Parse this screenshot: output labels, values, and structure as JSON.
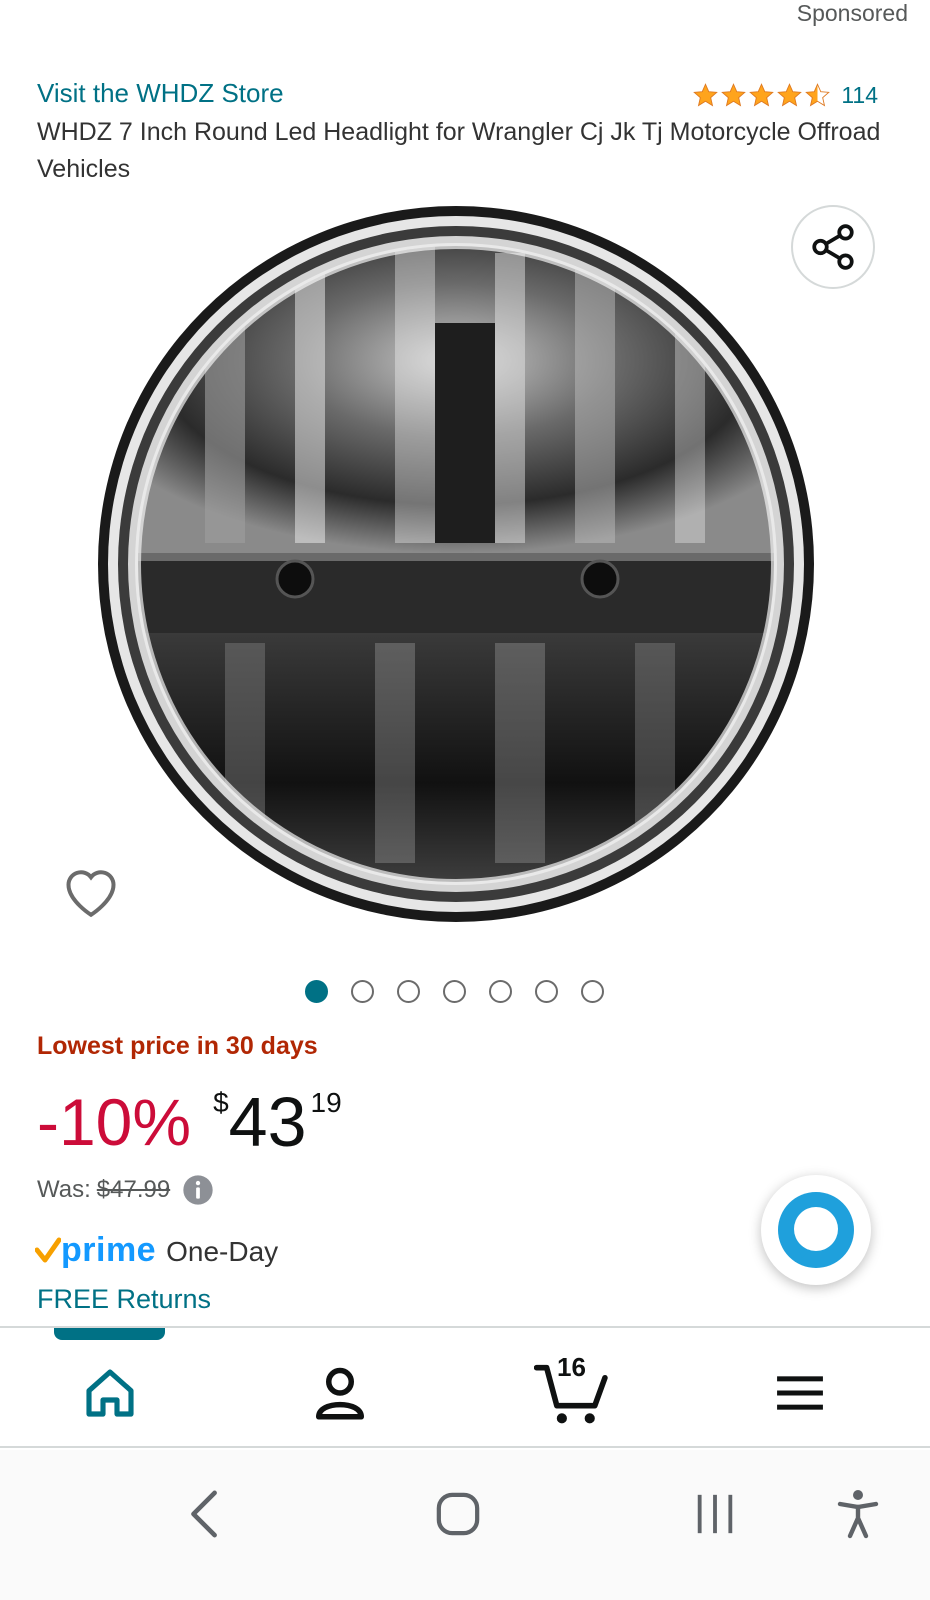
{
  "header": {
    "sponsored": "Sponsored"
  },
  "product": {
    "store_link": "Visit the WHDZ Store",
    "rating_stars": 4.5,
    "rating_count": "114",
    "title": "WHDZ 7 Inch Round Led Headlight for Wrangler Cj Jk Tj Motorcycle Offroad Vehicles",
    "image_icon": "round-led-headlight-photo"
  },
  "gallery": {
    "total_images": 7,
    "active_index": 0
  },
  "pricing": {
    "deal_label": "Lowest price in 30 days",
    "discount": "-10%",
    "currency_symbol": "$",
    "price_whole": "43",
    "price_fraction": "19",
    "was_label": "Was:",
    "was_price": "$47.99"
  },
  "delivery": {
    "prime_word": "prime",
    "prime_speed": "One-Day",
    "free_returns": "FREE Returns"
  },
  "bottom_nav": {
    "cart_count": "16",
    "active_tab": "home"
  },
  "colors": {
    "link": "#007185",
    "deal": "#b12704",
    "discount": "#cc0c39",
    "star": "#ffa41c",
    "prime_blue": "#1399ff",
    "prime_check": "#f7a000",
    "alexa": "#1fa0dc"
  }
}
